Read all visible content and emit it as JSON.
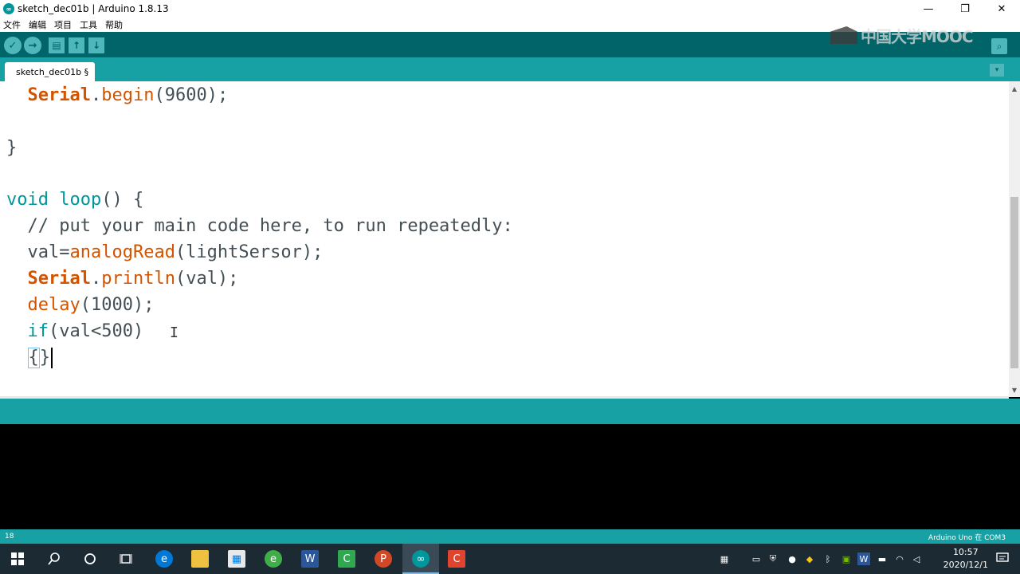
{
  "window": {
    "title": "sketch_dec01b | Arduino 1.8.13",
    "min_glyph": "—",
    "restore_glyph": "❐",
    "close_glyph": "✕"
  },
  "menu": [
    "文件",
    "编辑",
    "项目",
    "工具",
    "帮助"
  ],
  "toolbar": {
    "verify_glyph": "✓",
    "upload_glyph": "→",
    "new_glyph": "▤",
    "open_glyph": "↑",
    "save_glyph": "↓",
    "serial_glyph": "⌕"
  },
  "watermark": "中国大学MOOC",
  "tab": {
    "label": "sketch_dec01b §",
    "menu_glyph": "▾"
  },
  "code": {
    "l1_obj": "Serial",
    "l1_dot": ".",
    "l1_fn": "begin",
    "l1_rest": "(9600);",
    "l2": "}",
    "l3_kw": "void",
    "l3_fn": "loop",
    "l3_rest": "() {",
    "l4": "// put your main code here, to run repeatedly:",
    "l5_a": "val=",
    "l5_fn": "analogRead",
    "l5_rest": "(lightSersor);",
    "l6_obj": "Serial",
    "l6_dot": ".",
    "l6_fn": "println",
    "l6_rest": "(val);",
    "l7_fn": "delay",
    "l7_rest": "(1000);",
    "l8_kw": "if",
    "l8_rest": "(val<500)",
    "l9_open": "{",
    "l9_close": "}",
    "cursor_glyph": "I"
  },
  "status": {
    "line_number": "18",
    "board": "Arduino Uno 在 COM3"
  },
  "taskbar": {
    "clock_time": "10:57",
    "clock_date": "2020/12/1",
    "icons": [
      "windows-start",
      "search",
      "cortana",
      "task-view",
      "edge",
      "file-explorer",
      "store",
      "360-browser",
      "word",
      "camtasia",
      "powerpoint",
      "arduino",
      "camtasia-recorder"
    ]
  },
  "colors": {
    "toolbar": "#006468",
    "tabbar": "#17a1a5",
    "keyword_orange": "#d35400",
    "keyword_teal": "#00979c"
  }
}
